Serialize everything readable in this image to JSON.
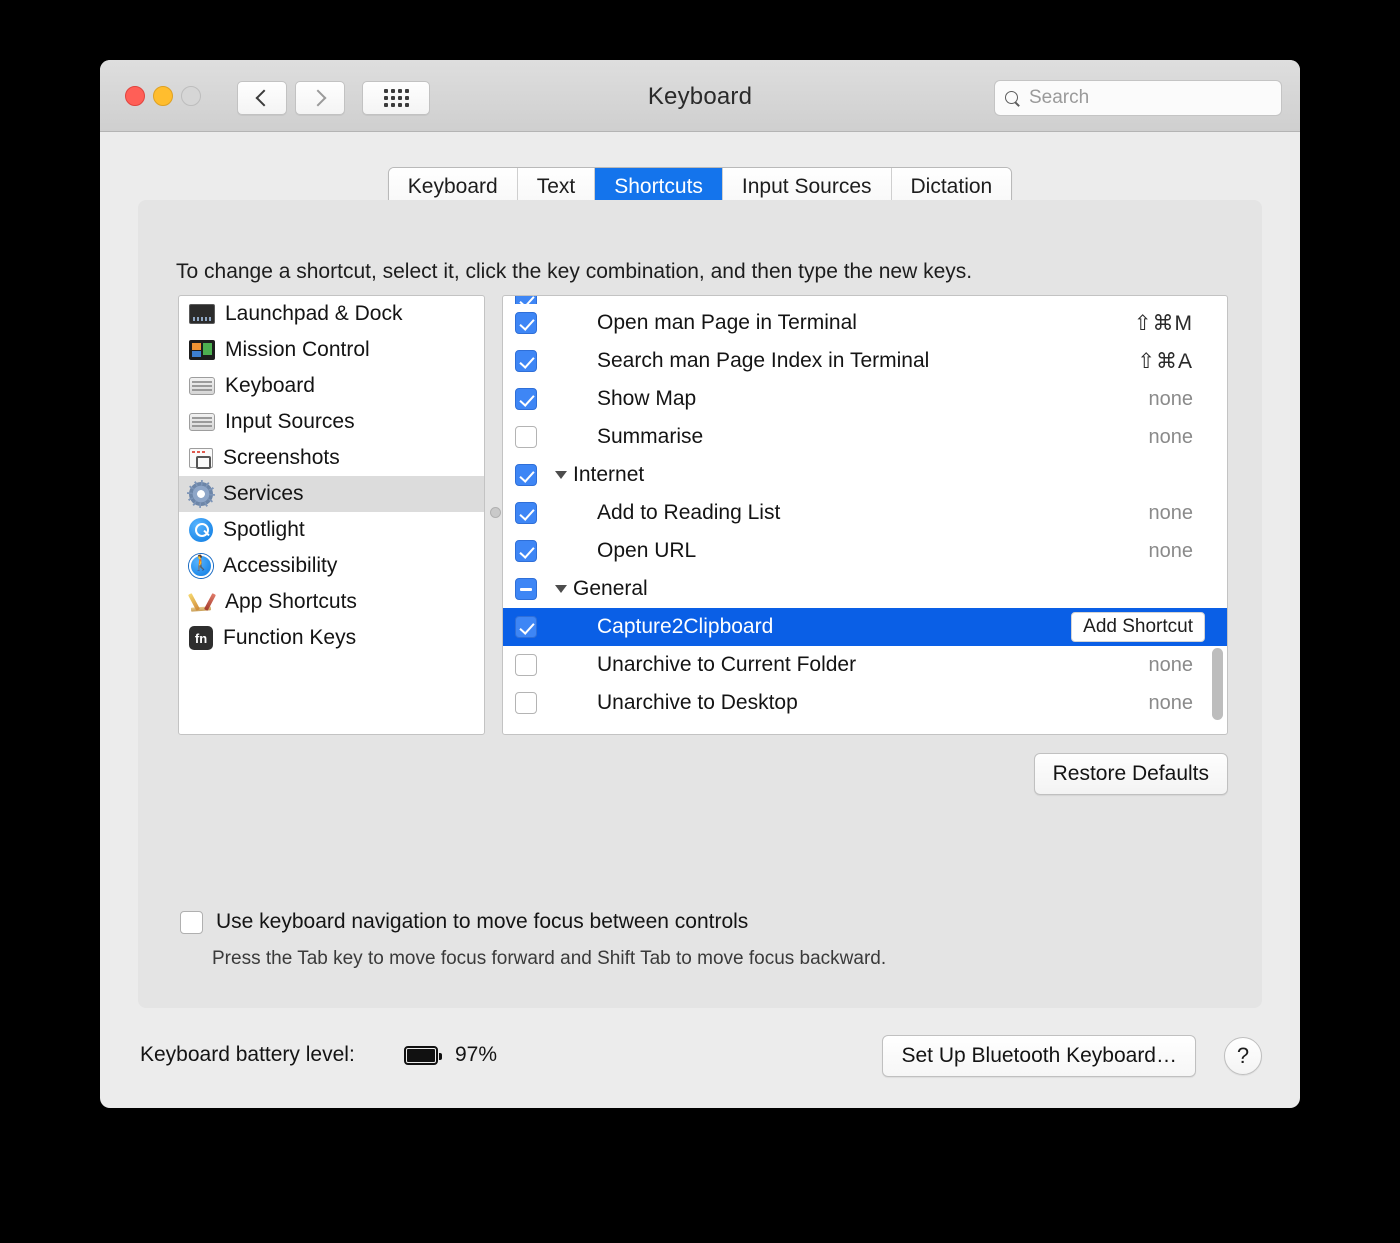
{
  "window": {
    "title": "Keyboard",
    "traffic_lights": [
      "close-red",
      "minimize-yellow",
      "zoom-disabled-gray"
    ],
    "nav": {
      "back": "‹",
      "forward": "›",
      "grid": "grid-icon"
    }
  },
  "search": {
    "placeholder": "Search",
    "value": ""
  },
  "tabs": [
    {
      "label": "Keyboard",
      "active": false
    },
    {
      "label": "Text",
      "active": false
    },
    {
      "label": "Shortcuts",
      "active": true
    },
    {
      "label": "Input Sources",
      "active": false
    },
    {
      "label": "Dictation",
      "active": false
    }
  ],
  "main": {
    "hint": "To change a shortcut, select it, click the key combination, and then type the new keys.",
    "restore_defaults_label": "Restore Defaults"
  },
  "sidebar": {
    "items": [
      {
        "label": "Launchpad & Dock",
        "icon": "launchpad-dock-icon",
        "selected": false
      },
      {
        "label": "Mission Control",
        "icon": "mission-control-icon",
        "selected": false
      },
      {
        "label": "Keyboard",
        "icon": "keyboard-icon",
        "selected": false
      },
      {
        "label": "Input Sources",
        "icon": "input-sources-icon",
        "selected": false
      },
      {
        "label": "Screenshots",
        "icon": "screenshots-icon",
        "selected": false
      },
      {
        "label": "Services",
        "icon": "services-gear-icon",
        "selected": true
      },
      {
        "label": "Spotlight",
        "icon": "spotlight-icon",
        "selected": false
      },
      {
        "label": "Accessibility",
        "icon": "accessibility-icon",
        "selected": false
      },
      {
        "label": "App Shortcuts",
        "icon": "app-shortcuts-icon",
        "selected": false
      },
      {
        "label": "Function Keys",
        "icon": "function-keys-icon",
        "selected": false
      }
    ]
  },
  "shortcut_list": {
    "rows": [
      {
        "label": "",
        "checkbox": "checked",
        "shortcut": "",
        "type": "partial",
        "selected": false
      },
      {
        "label": "Open man Page in Terminal",
        "checkbox": "checked",
        "shortcut": "⇧⌘M",
        "type": "item",
        "selected": false
      },
      {
        "label": "Search man Page Index in Terminal",
        "checkbox": "checked",
        "shortcut": "⇧⌘A",
        "type": "item",
        "selected": false
      },
      {
        "label": "Show Map",
        "checkbox": "checked",
        "shortcut": "none",
        "type": "item",
        "selected": false
      },
      {
        "label": "Summarise",
        "checkbox": "unchecked",
        "shortcut": "none",
        "type": "item",
        "selected": false
      },
      {
        "label": "Internet",
        "checkbox": "checked",
        "shortcut": "",
        "type": "group",
        "selected": false
      },
      {
        "label": "Add to Reading List",
        "checkbox": "checked",
        "shortcut": "none",
        "type": "item",
        "selected": false
      },
      {
        "label": "Open URL",
        "checkbox": "checked",
        "shortcut": "none",
        "type": "item",
        "selected": false
      },
      {
        "label": "General",
        "checkbox": "mixed",
        "shortcut": "",
        "type": "group",
        "selected": false
      },
      {
        "label": "Capture2Clipboard",
        "checkbox": "checked",
        "shortcut": "Add Shortcut",
        "type": "item-button",
        "selected": true
      },
      {
        "label": "Unarchive to Current Folder",
        "checkbox": "unchecked",
        "shortcut": "none",
        "type": "item",
        "selected": false
      },
      {
        "label": "Unarchive to Desktop",
        "checkbox": "unchecked",
        "shortcut": "none",
        "type": "item",
        "selected": false
      }
    ]
  },
  "keyboard_nav": {
    "label": "Use keyboard navigation to move focus between controls",
    "checked": false,
    "sublabel": "Press the Tab key to move focus forward and Shift Tab to move focus backward."
  },
  "footer": {
    "battery_label": "Keyboard battery level:",
    "battery_percent": "97%",
    "bluetooth_button": "Set Up Bluetooth Keyboard…",
    "help_button": "?"
  },
  "colors": {
    "accent_blue": "#1474ec",
    "selection_blue": "#0a5fe6",
    "checkbox_blue": "#3e86f5",
    "window_bg": "#ececec",
    "panel_bg": "#e4e4e4"
  }
}
